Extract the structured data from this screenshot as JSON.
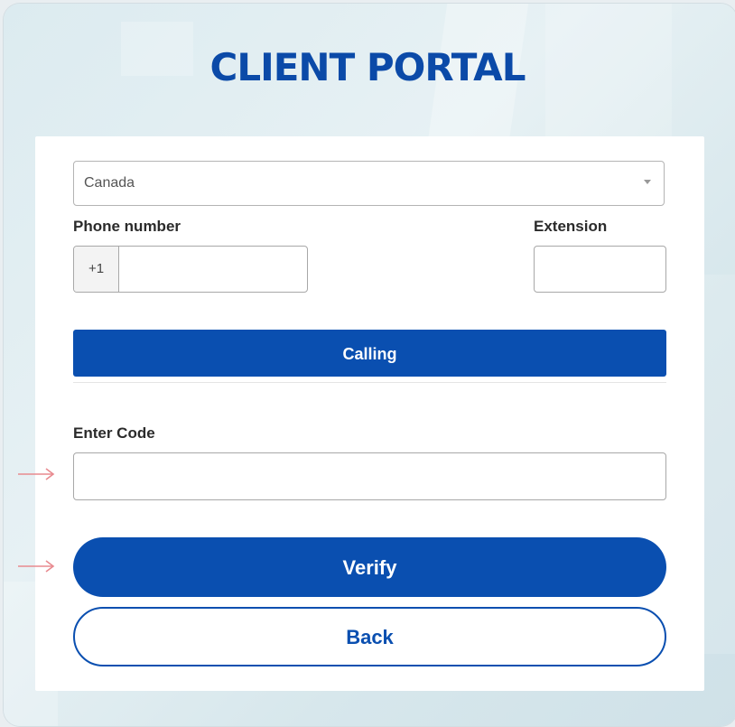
{
  "header": {
    "title": "CLIENT PORTAL"
  },
  "form": {
    "country": {
      "selected": "Canada"
    },
    "phone": {
      "label": "Phone number",
      "prefix": "+1",
      "value": ""
    },
    "extension": {
      "label": "Extension",
      "value": ""
    },
    "calling_button": "Calling",
    "code": {
      "label": "Enter Code",
      "value": "",
      "placeholder": ""
    },
    "verify_button": "Verify",
    "back_button": "Back"
  },
  "annotations": {
    "arrow_color": "#e88a8f"
  },
  "colors": {
    "brand": "#0a4fb0",
    "title": "#0b4aa8"
  }
}
